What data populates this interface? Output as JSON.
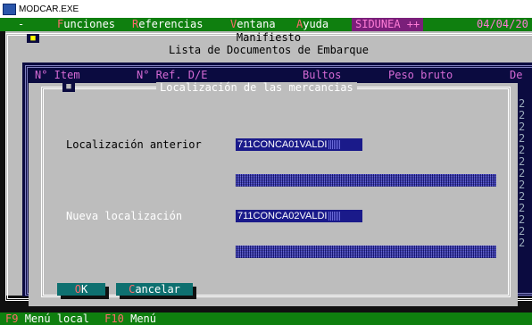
{
  "window": {
    "title": "MODCAR.EXE"
  },
  "menu": {
    "dash": "-",
    "items": [
      {
        "hot": "F",
        "rest": "unciones"
      },
      {
        "hot": "R",
        "rest": "eferencias"
      },
      {
        "hot": "V",
        "rest": "entana"
      },
      {
        "hot": "A",
        "rest": "yuda"
      }
    ],
    "system_badge": "SIDUNEA ++",
    "date": "04/04/20"
  },
  "manifest": {
    "title": "Manifiesto",
    "subtitle": "Lista de Documentos de Embarque",
    "columns": [
      "N° Item",
      "N° Ref. D/E",
      "Bultos",
      "Peso bruto",
      "De"
    ],
    "right_digits": [
      "2",
      "2",
      "2",
      "2",
      "2",
      "2",
      "2",
      "2",
      "2",
      "2",
      "2",
      "2",
      "2"
    ]
  },
  "dialog": {
    "title": "Localización de las mercancias",
    "prev_label": "Localización anterior",
    "prev_value": "711CONCA01VALDI",
    "new_label": "Nueva localización",
    "new_value": "711CONCA02VALDI",
    "ok": {
      "hot": "O",
      "rest": "K"
    },
    "cancel": {
      "hot": "C",
      "rest": "ancelar"
    }
  },
  "statusbar": {
    "f9_key": "F9",
    "f9_label": "Menú local",
    "f10_key": "F10",
    "f10_label": "Menú"
  },
  "colors": {
    "menu_green": "#0f7f0f",
    "window_grey": "#bdbdbd",
    "field_blue": "#1a1a8a",
    "button_teal": "#0e7070",
    "hotkey_red": "#ff6b6b",
    "badge_magenta": "#7a1f7a"
  }
}
